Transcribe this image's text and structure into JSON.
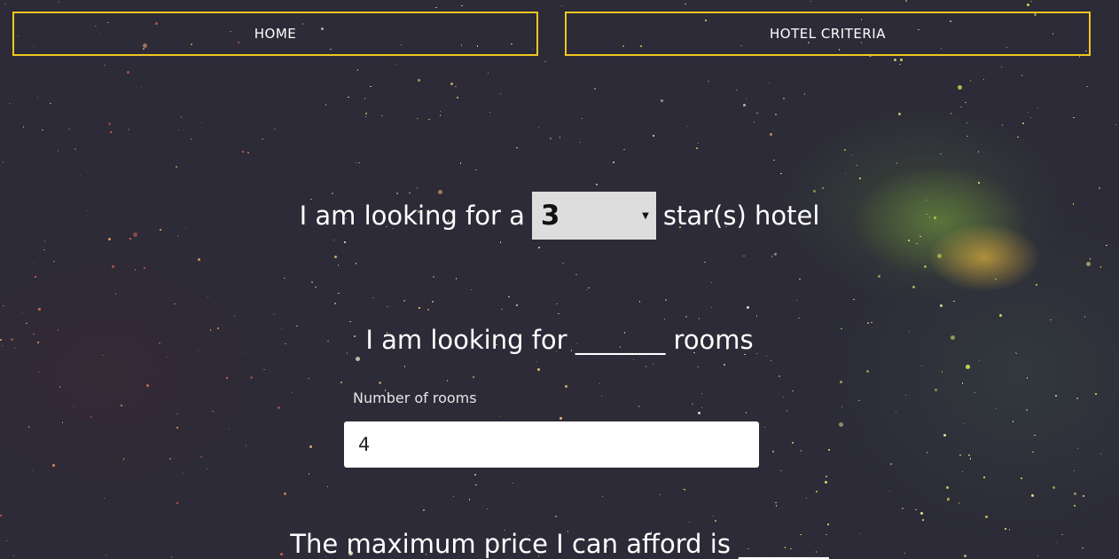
{
  "nav": {
    "home_label": "HOME",
    "criteria_label": "HOTEL CRITERIA",
    "border_color": "#f1c623"
  },
  "stars_question": {
    "prefix": "I am looking for a",
    "selected_value": "3",
    "suffix": "star(s) hotel"
  },
  "rooms_question": {
    "text": "I am looking for _______ rooms",
    "field_label": "Number of rooms",
    "field_value": "4"
  },
  "price_question": {
    "text": "The maximum price I can afford is _______"
  }
}
